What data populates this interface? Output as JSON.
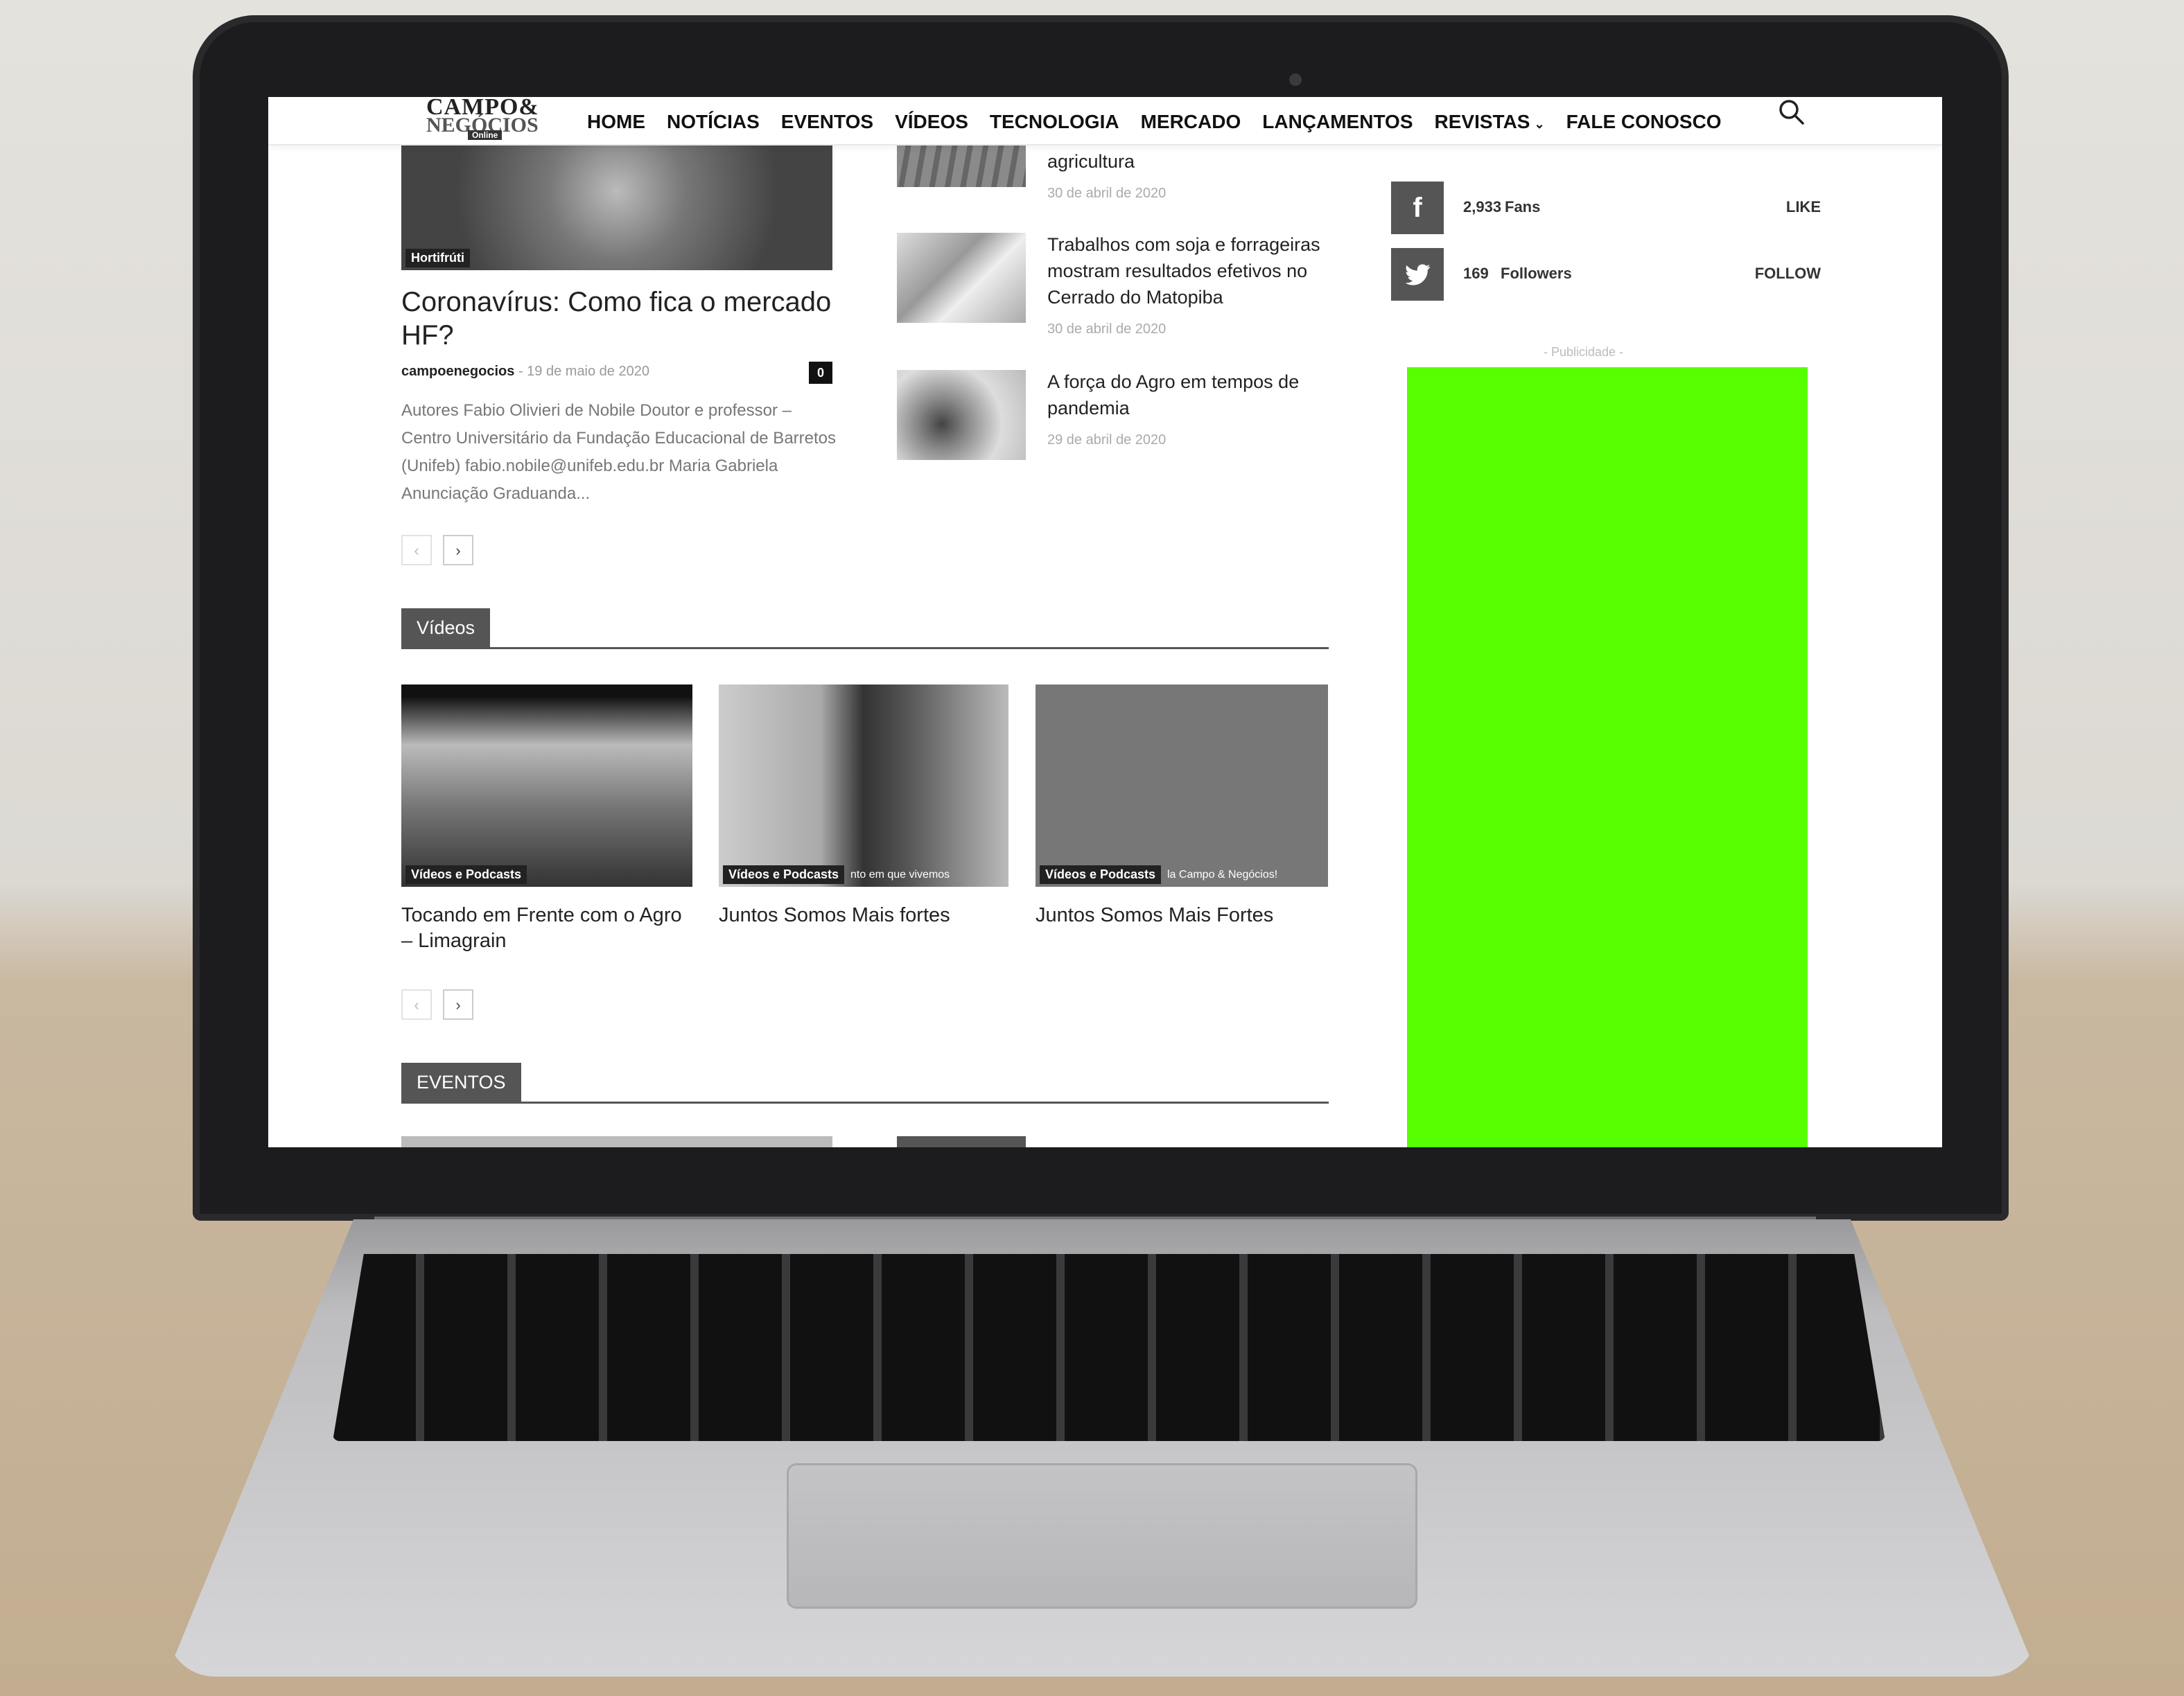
{
  "site": {
    "logo": {
      "line1": "CAMPO&",
      "line2": "NEGÓCIOS",
      "line3": "Online"
    },
    "nav": [
      "HOME",
      "NOTÍCIAS",
      "EVENTOS",
      "VÍDEOS",
      "TECNOLOGIA",
      "MERCADO",
      "LANÇAMENTOS",
      "REVISTAS",
      "FALE CONOSCO"
    ],
    "nav_dropdown_chevron": "⌄"
  },
  "lead_article": {
    "tag": "Hortifrúti",
    "title": "Coronavírus: Como fica o mercado HF?",
    "author": "campoenegocios",
    "date": "19 de maio de 2020",
    "comments": "0",
    "excerpt": "Autores Fabio Olivieri de Nobile Doutor e professor – Centro Universitário da Fundação Educacional de Barretos (Unifeb) fabio.nobile@unifeb.edu.br Maria Gabriela Anunciação Graduanda..."
  },
  "side_articles": [
    {
      "title": "agricultura",
      "date": "30 de abril de 2020"
    },
    {
      "title": "Trabalhos com soja e forrageiras mostram resultados efetivos no Cerrado do Matopiba",
      "date": "30 de abril de 2020"
    },
    {
      "title": "A força do Agro em tempos de pandemia",
      "date": "29 de abril de 2020"
    }
  ],
  "pager": {
    "prev": "‹",
    "next": "›"
  },
  "videos_section": {
    "label": "Vídeos",
    "items": [
      {
        "tag": "Vídeos e Podcasts",
        "title": "Tocando em Frente com o Agro – Limagrain"
      },
      {
        "tag": "Vídeos e Podcasts",
        "title": "Juntos Somos Mais fortes",
        "overlay": "nto em que vivemos"
      },
      {
        "tag": "Vídeos e Podcasts",
        "title": "Juntos Somos Mais Fortes",
        "overlay": "la Campo & Negócios!"
      }
    ]
  },
  "events_section": {
    "label": "EVENTOS"
  },
  "social": [
    {
      "icon": "facebook-icon",
      "glyph": "f",
      "count": "2,933",
      "label": "Fans",
      "action": "LIKE"
    },
    {
      "icon": "twitter-icon",
      "glyph": "t",
      "count": "169",
      "label": "Followers",
      "action": "FOLLOW"
    }
  ],
  "ad": {
    "label": "- Publicidade -",
    "color": "#57ff00"
  }
}
